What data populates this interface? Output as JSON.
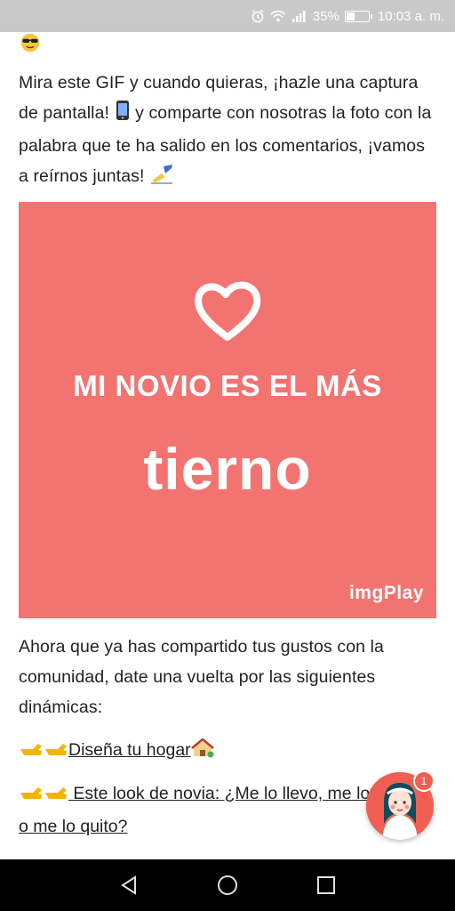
{
  "status_bar": {
    "battery_percent": "35%",
    "battery_level": 0.35,
    "time": "10:03 a. m.",
    "icons": [
      "alarm-icon",
      "wifi-icon",
      "signal-icon",
      "battery-icon"
    ]
  },
  "post": {
    "top_emoji": "smiling-face-with-sunglasses",
    "intro_text_1": "Mira este GIF y cuando quieras, ¡hazle una captura de pantalla! ",
    "intro_emoji_1": "mobile-phone",
    "intro_text_2": " y comparte con nosotras la foto con la palabra que te ha salido en los comentarios, ¡vamos a reírnos juntas! ",
    "intro_emoji_2": "writing-hand",
    "gif": {
      "line1": "MI NOVIO ES EL MÁS",
      "line2": "tierno",
      "logo": "imgPlay",
      "background": "#f37370",
      "icon": "heart-outline"
    },
    "outro_text": "Ahora que ya has compartido tus gustos con la comunidad, date una vuelta por las siguientes dinámicas:",
    "links": [
      {
        "emoji": "pointing-hands",
        "label": "Diseña tu hogar",
        "trail_emoji": "house-with-garden"
      },
      {
        "emoji": "pointing-hands",
        "label": " Este look de novia: ¿Me lo llevo, me lo pruebo o me lo quito?"
      }
    ]
  },
  "fab": {
    "badge_count": "1",
    "color": "#f05f52"
  },
  "nav_bar": {
    "buttons": [
      "back",
      "home",
      "recents"
    ]
  }
}
